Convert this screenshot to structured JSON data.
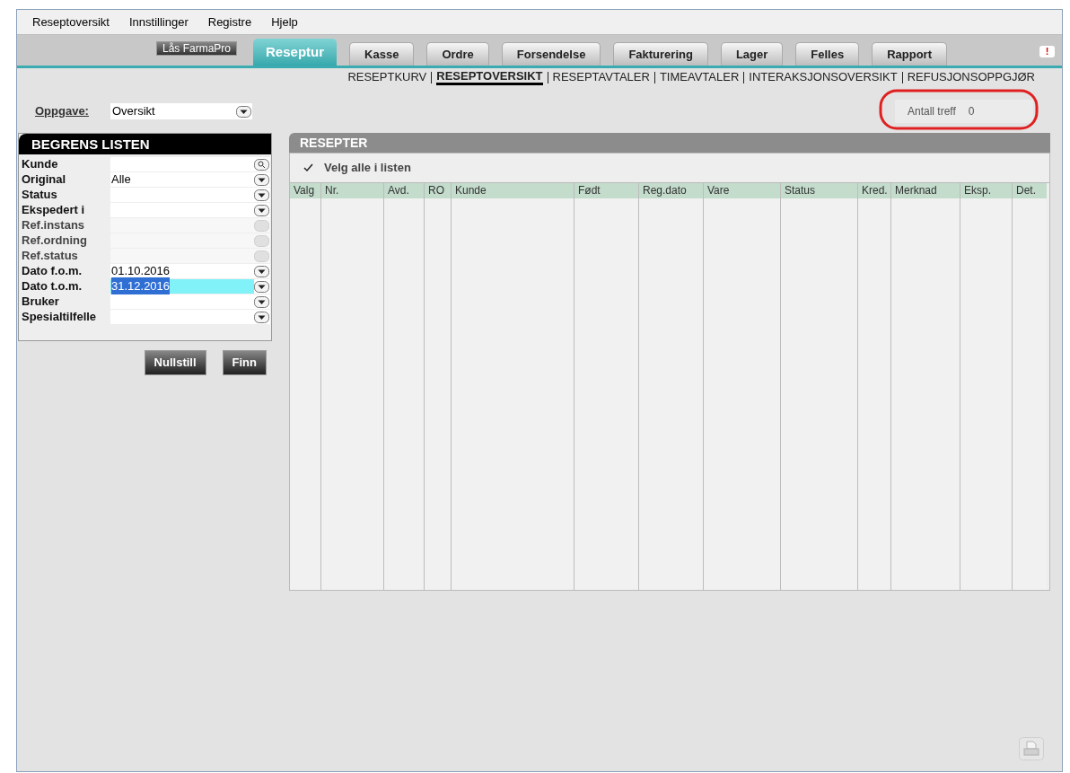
{
  "menu": [
    "Reseptoversikt",
    "Innstillinger",
    "Registre",
    "Hjelp"
  ],
  "lock_button": "Lås FarmaPro",
  "tabs": [
    {
      "label": "Reseptur",
      "selected": true
    },
    {
      "label": "Kasse",
      "selected": false
    },
    {
      "label": "Ordre",
      "selected": false
    },
    {
      "label": "Forsendelse",
      "selected": false
    },
    {
      "label": "Fakturering",
      "selected": false
    },
    {
      "label": "Lager",
      "selected": false
    },
    {
      "label": "Felles",
      "selected": false
    },
    {
      "label": "Rapport",
      "selected": false
    }
  ],
  "alert_icon": "!",
  "subnav": [
    {
      "label": "RESEPTKURV",
      "selected": false
    },
    {
      "label": "RESEPTOVERSIKT",
      "selected": true
    },
    {
      "label": "RESEPTAVTALER",
      "selected": false
    },
    {
      "label": "TIMEAVTALER",
      "selected": false
    },
    {
      "label": "INTERAKSJONSOVERSIKT",
      "selected": false
    },
    {
      "label": "REFUSJONSOPPGJØR",
      "selected": false
    }
  ],
  "task": {
    "label": "Oppgave:",
    "value": "Oversikt"
  },
  "hits": {
    "label": "Antall treff",
    "value": "0"
  },
  "filter": {
    "title": "BEGRENS LISTEN",
    "fields": [
      {
        "label": "Kunde",
        "kind": "search",
        "disabled": false
      },
      {
        "label": "Original",
        "value": "Alle",
        "kind": "dropdown",
        "disabled": false
      },
      {
        "label": "Status",
        "kind": "dropdown",
        "disabled": false
      },
      {
        "label": "Ekspedert i",
        "kind": "dropdown",
        "disabled": false
      },
      {
        "label": "Ref.instans",
        "kind": "search",
        "disabled": true
      },
      {
        "label": "Ref.ordning",
        "kind": "dropdown",
        "disabled": true
      },
      {
        "label": "Ref.status",
        "kind": "dropdown",
        "disabled": true
      },
      {
        "label": "Dato f.o.m.",
        "value": "01.10.2016",
        "kind": "dropdown",
        "disabled": false
      },
      {
        "label": "Dato t.o.m.",
        "value": "31.12.2016",
        "kind": "dropdown",
        "disabled": false,
        "selected": true
      },
      {
        "label": "Bruker",
        "kind": "dropdown",
        "disabled": false
      },
      {
        "label": "Spesialtilfelle",
        "kind": "dropdown",
        "disabled": false
      }
    ],
    "buttons": [
      "Nullstill",
      "Finn"
    ]
  },
  "prescriptions": {
    "title": "RESEPTER",
    "select_all": {
      "label": "Velg alle i listen",
      "checked": true
    },
    "columns": [
      "Valg",
      "Nr.",
      "Avd.",
      "RO",
      "Kunde",
      "Født",
      "Reg.dato",
      "Vare",
      "Status",
      "Kred.",
      "Merknad",
      "Eksp.",
      "Det."
    ]
  }
}
